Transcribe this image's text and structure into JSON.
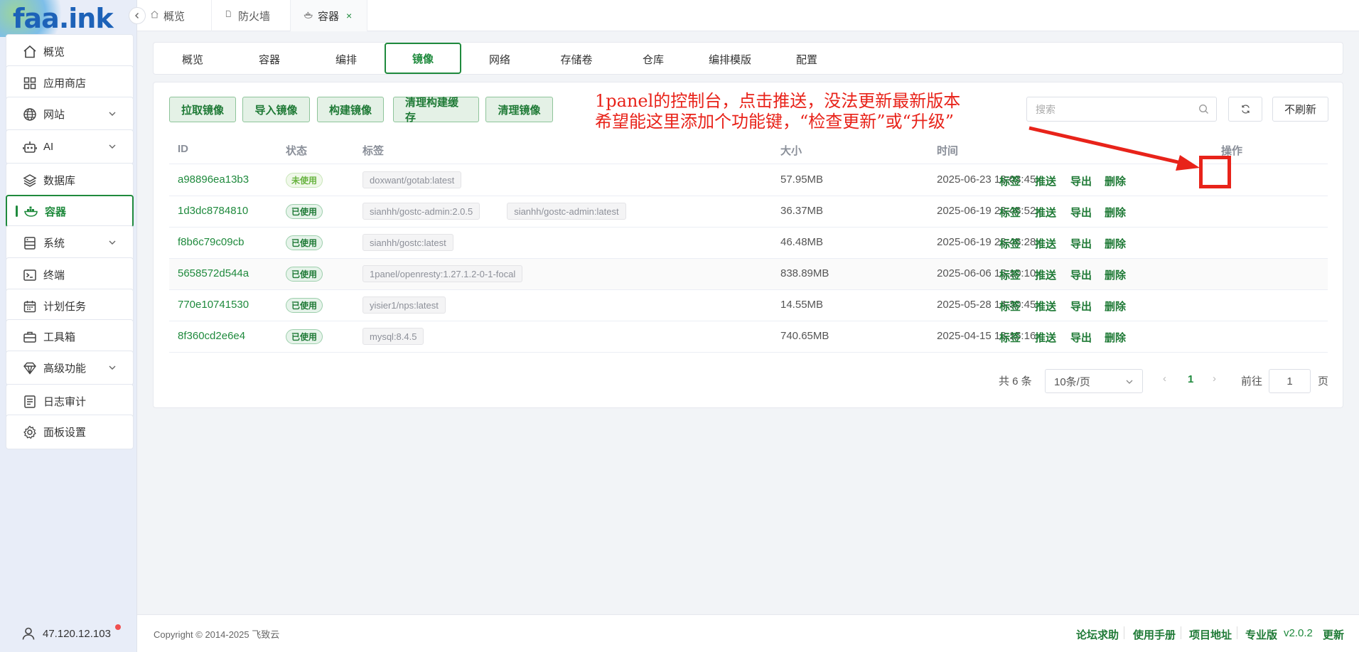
{
  "brand": {
    "logo": "faa.ink"
  },
  "sidebar": {
    "items": [
      {
        "label": "概览",
        "icon": "home-icon"
      },
      {
        "label": "应用商店",
        "icon": "grid-icon"
      },
      {
        "label": "网站",
        "icon": "globe-icon",
        "expandable": true
      },
      {
        "label": "AI",
        "icon": "robot-icon",
        "expandable": true
      },
      {
        "label": "数据库",
        "icon": "layers-icon"
      },
      {
        "label": "容器",
        "icon": "docker-icon",
        "active": true
      },
      {
        "label": "系统",
        "icon": "server-icon",
        "expandable": true
      },
      {
        "label": "终端",
        "icon": "terminal-icon"
      },
      {
        "label": "计划任务",
        "icon": "calendar-icon"
      },
      {
        "label": "工具箱",
        "icon": "toolbox-icon"
      },
      {
        "label": "高级功能",
        "icon": "diamond-icon",
        "expandable": true
      },
      {
        "label": "日志审计",
        "icon": "log-icon"
      },
      {
        "label": "面板设置",
        "icon": "gear-icon"
      }
    ],
    "ip": "47.120.12.103"
  },
  "tabs": [
    {
      "label": "概览",
      "icon": "home-icon"
    },
    {
      "label": "防火墙",
      "icon": "document-icon"
    },
    {
      "label": "容器",
      "icon": "docker-icon",
      "active": true,
      "close": "×"
    }
  ],
  "subnav": [
    {
      "label": "概览"
    },
    {
      "label": "容器"
    },
    {
      "label": "编排"
    },
    {
      "label": "镜像",
      "active": true
    },
    {
      "label": "网络"
    },
    {
      "label": "存储卷"
    },
    {
      "label": "仓库"
    },
    {
      "label": "编排模版"
    },
    {
      "label": "配置"
    }
  ],
  "toolbar": {
    "buttons": [
      "拉取镜像",
      "导入镜像",
      "构建镜像",
      "清理构建缓存",
      "清理镜像"
    ],
    "search_placeholder": "搜索",
    "no_refresh": "不刷新"
  },
  "table": {
    "headers": [
      "ID",
      "状态",
      "标签",
      "大小",
      "时间",
      "操作"
    ],
    "actions": [
      "标签",
      "推送",
      "导出",
      "删除"
    ],
    "rows": [
      {
        "id": "a98896ea13b3",
        "status": "未使用",
        "status_type": "unused",
        "tags": [
          "doxwant/gotab:latest"
        ],
        "size": "57.95MB",
        "time": "2025-06-23 18:03:45"
      },
      {
        "id": "1d3dc8784810",
        "status": "已使用",
        "status_type": "used",
        "tags": [
          "sianhh/gostc-admin:2.0.5",
          "sianhh/gostc-admin:latest"
        ],
        "size": "36.37MB",
        "time": "2025-06-19 23:46:52"
      },
      {
        "id": "f8b6c79c09cb",
        "status": "已使用",
        "status_type": "used",
        "tags": [
          "sianhh/gostc:latest"
        ],
        "size": "46.48MB",
        "time": "2025-06-19 23:46:28"
      },
      {
        "id": "5658572d544a",
        "status": "已使用",
        "status_type": "used",
        "tags": [
          "1panel/openresty:1.27.1.2-0-1-focal"
        ],
        "size": "838.89MB",
        "time": "2025-06-06 15:10:10"
      },
      {
        "id": "770e10741530",
        "status": "已使用",
        "status_type": "used",
        "tags": [
          "yisier1/nps:latest"
        ],
        "size": "14.55MB",
        "time": "2025-05-28 14:30:45"
      },
      {
        "id": "8f360cd2e6e4",
        "status": "已使用",
        "status_type": "used",
        "tags": [
          "mysql:8.4.5"
        ],
        "size": "740.65MB",
        "time": "2025-04-15 18:15:16"
      }
    ]
  },
  "pagination": {
    "total": "共 6 条",
    "page_size": "10条/页",
    "prev": "‹",
    "current": "1",
    "next": "›",
    "goto": "前往",
    "goto_value": "1",
    "page_suffix": "页"
  },
  "annotation": {
    "line1": "1panel的控制台，点击推送，没法更新最新版本",
    "line2": "希望能这里添加个功能键，“检查更新”或“升级”",
    "color": "#e8231a"
  },
  "footer": {
    "copyright": "Copyright © 2014-2025 飞致云",
    "links": [
      "论坛求助",
      "使用手册",
      "项目地址",
      "专业版"
    ],
    "version": "v2.0.2",
    "update": "更新"
  },
  "colors": {
    "accent": "#1f8a3d",
    "brand": "#1d62b8",
    "annotation": "#e8231a"
  }
}
